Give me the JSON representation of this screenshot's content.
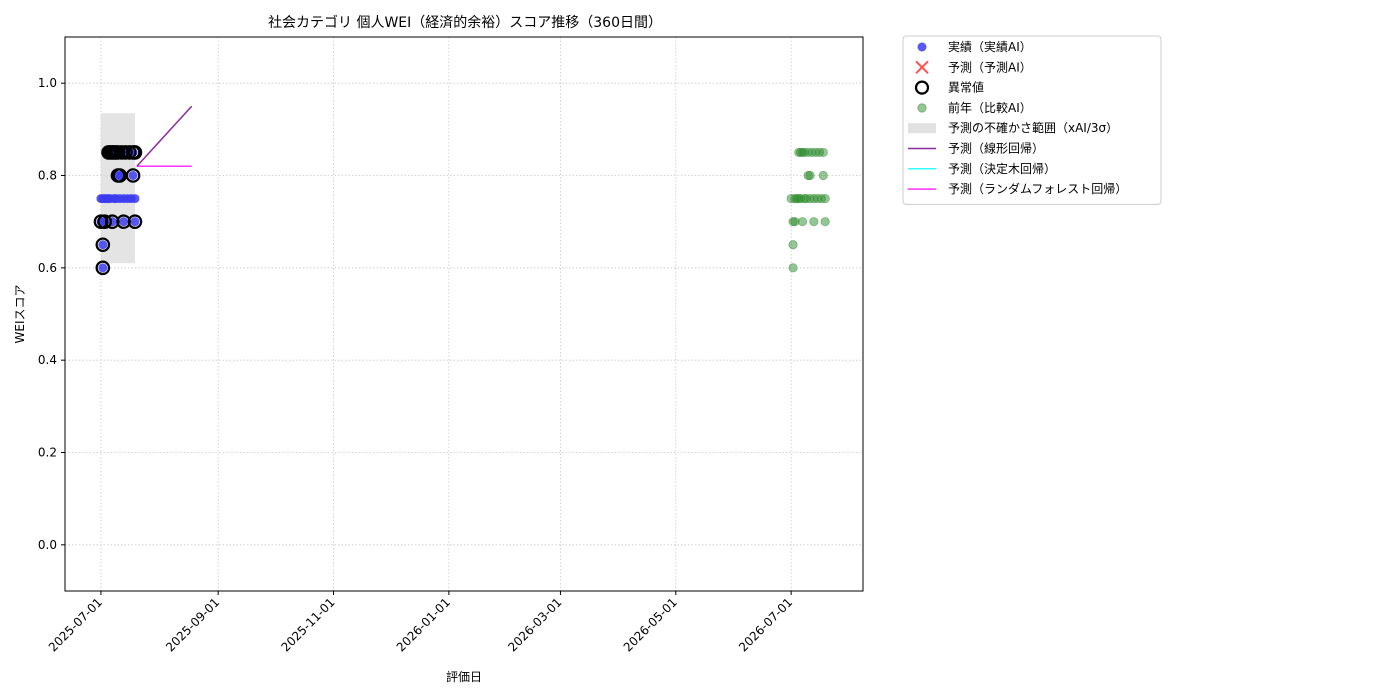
{
  "chart_data": {
    "type": "scatter",
    "title": "社会カテゴリ 個人WEI（経済的余裕）スコア推移（360日間）",
    "xlabel": "評価日",
    "ylabel": "WEIスコア",
    "xlim": [
      "2025-06-12",
      "2026-08-08"
    ],
    "ylim": [
      -0.1,
      1.1
    ],
    "xticks": [
      "2025-07-01",
      "2025-09-01",
      "2025-11-01",
      "2026-01-01",
      "2026-03-01",
      "2026-05-01",
      "2026-07-01"
    ],
    "yticks": [
      0.0,
      0.2,
      0.4,
      0.6,
      0.8,
      1.0
    ],
    "ytick_labels": [
      "0.0",
      "0.2",
      "0.4",
      "0.6",
      "0.8",
      "1.0"
    ],
    "grid": true,
    "legend_position": "outside-upper-right",
    "colors": {
      "actual": "#3b3bf0",
      "forecast": "#ff3333",
      "anomaly": "#000000",
      "previous_year": "#2e8b2e",
      "uncertainty": "#d9d9d9",
      "linear": "#8b2a9e",
      "tree": "#33ffff",
      "forest": "#ff33ff"
    },
    "legend": [
      {
        "key": "actual",
        "label": "実績（実績AI）",
        "marker": "dot"
      },
      {
        "key": "forecast",
        "label": "予測（予測AI）",
        "marker": "x"
      },
      {
        "key": "anomaly",
        "label": "異常値",
        "marker": "ring"
      },
      {
        "key": "previous_year",
        "label": "前年（比較AI）",
        "marker": "dot-faded"
      },
      {
        "key": "uncertainty",
        "label": "予測の不確かさ範囲（xAI/3σ）",
        "marker": "patch"
      },
      {
        "key": "linear",
        "label": "予測（線形回帰）",
        "marker": "line"
      },
      {
        "key": "tree",
        "label": "予測（決定木回帰）",
        "marker": "line"
      },
      {
        "key": "forest",
        "label": "予測（ランダムフォレスト回帰）",
        "marker": "line"
      }
    ],
    "series": [
      {
        "key": "actual",
        "type": "scatter",
        "points": [
          {
            "x": "2025-07-01",
            "y": 0.75
          },
          {
            "x": "2025-07-01",
            "y": 0.7
          },
          {
            "x": "2025-07-02",
            "y": 0.6
          },
          {
            "x": "2025-07-02",
            "y": 0.65
          },
          {
            "x": "2025-07-02",
            "y": 0.75
          },
          {
            "x": "2025-07-03",
            "y": 0.7
          },
          {
            "x": "2025-07-03",
            "y": 0.75
          },
          {
            "x": "2025-07-04",
            "y": 0.75
          },
          {
            "x": "2025-07-05",
            "y": 0.85
          },
          {
            "x": "2025-07-05",
            "y": 0.75
          },
          {
            "x": "2025-07-06",
            "y": 0.85
          },
          {
            "x": "2025-07-06",
            "y": 0.75
          },
          {
            "x": "2025-07-07",
            "y": 0.7
          },
          {
            "x": "2025-07-07",
            "y": 0.85
          },
          {
            "x": "2025-07-08",
            "y": 0.75
          },
          {
            "x": "2025-07-08",
            "y": 0.85
          },
          {
            "x": "2025-07-09",
            "y": 0.75
          },
          {
            "x": "2025-07-10",
            "y": 0.8
          },
          {
            "x": "2025-07-10",
            "y": 0.85
          },
          {
            "x": "2025-07-11",
            "y": 0.75
          },
          {
            "x": "2025-07-11",
            "y": 0.8
          },
          {
            "x": "2025-07-12",
            "y": 0.85
          },
          {
            "x": "2025-07-13",
            "y": 0.7
          },
          {
            "x": "2025-07-13",
            "y": 0.75
          },
          {
            "x": "2025-07-14",
            "y": 0.85
          },
          {
            "x": "2025-07-15",
            "y": 0.75
          },
          {
            "x": "2025-07-16",
            "y": 0.85
          },
          {
            "x": "2025-07-17",
            "y": 0.75
          },
          {
            "x": "2025-07-18",
            "y": 0.8
          },
          {
            "x": "2025-07-18",
            "y": 0.85
          },
          {
            "x": "2025-07-19",
            "y": 0.7
          },
          {
            "x": "2025-07-19",
            "y": 0.75
          }
        ]
      },
      {
        "key": "anomaly",
        "type": "scatter",
        "points": [
          {
            "x": "2025-07-02",
            "y": 0.6
          },
          {
            "x": "2025-07-02",
            "y": 0.65
          },
          {
            "x": "2025-07-01",
            "y": 0.7
          },
          {
            "x": "2025-07-03",
            "y": 0.7
          },
          {
            "x": "2025-07-07",
            "y": 0.7
          },
          {
            "x": "2025-07-13",
            "y": 0.7
          },
          {
            "x": "2025-07-19",
            "y": 0.7
          },
          {
            "x": "2025-07-10",
            "y": 0.8
          },
          {
            "x": "2025-07-11",
            "y": 0.8
          },
          {
            "x": "2025-07-18",
            "y": 0.8
          },
          {
            "x": "2025-07-05",
            "y": 0.85
          },
          {
            "x": "2025-07-06",
            "y": 0.85
          },
          {
            "x": "2025-07-07",
            "y": 0.85
          },
          {
            "x": "2025-07-08",
            "y": 0.85
          },
          {
            "x": "2025-07-09",
            "y": 0.85
          },
          {
            "x": "2025-07-10",
            "y": 0.85
          },
          {
            "x": "2025-07-12",
            "y": 0.85
          },
          {
            "x": "2025-07-14",
            "y": 0.85
          },
          {
            "x": "2025-07-16",
            "y": 0.85
          },
          {
            "x": "2025-07-18",
            "y": 0.85
          },
          {
            "x": "2025-07-19",
            "y": 0.85
          }
        ]
      },
      {
        "key": "previous_year",
        "type": "scatter",
        "points": [
          {
            "x": "2026-07-01",
            "y": 0.75
          },
          {
            "x": "2026-07-02",
            "y": 0.6
          },
          {
            "x": "2026-07-02",
            "y": 0.7
          },
          {
            "x": "2026-07-02",
            "y": 0.65
          },
          {
            "x": "2026-07-03",
            "y": 0.7
          },
          {
            "x": "2026-07-03",
            "y": 0.75
          },
          {
            "x": "2026-07-04",
            "y": 0.75
          },
          {
            "x": "2026-07-05",
            "y": 0.85
          },
          {
            "x": "2026-07-05",
            "y": 0.75
          },
          {
            "x": "2026-07-06",
            "y": 0.85
          },
          {
            "x": "2026-07-06",
            "y": 0.75
          },
          {
            "x": "2026-07-07",
            "y": 0.7
          },
          {
            "x": "2026-07-07",
            "y": 0.85
          },
          {
            "x": "2026-07-08",
            "y": 0.75
          },
          {
            "x": "2026-07-08",
            "y": 0.85
          },
          {
            "x": "2026-07-09",
            "y": 0.75
          },
          {
            "x": "2026-07-10",
            "y": 0.8
          },
          {
            "x": "2026-07-10",
            "y": 0.85
          },
          {
            "x": "2026-07-11",
            "y": 0.75
          },
          {
            "x": "2026-07-11",
            "y": 0.8
          },
          {
            "x": "2026-07-12",
            "y": 0.85
          },
          {
            "x": "2026-07-13",
            "y": 0.7
          },
          {
            "x": "2026-07-13",
            "y": 0.75
          },
          {
            "x": "2026-07-14",
            "y": 0.85
          },
          {
            "x": "2026-07-15",
            "y": 0.75
          },
          {
            "x": "2026-07-16",
            "y": 0.85
          },
          {
            "x": "2026-07-17",
            "y": 0.75
          },
          {
            "x": "2026-07-18",
            "y": 0.8
          },
          {
            "x": "2026-07-18",
            "y": 0.85
          },
          {
            "x": "2026-07-19",
            "y": 0.7
          },
          {
            "x": "2026-07-19",
            "y": 0.75
          }
        ]
      },
      {
        "key": "uncertainty",
        "type": "band",
        "x_start": "2025-07-01",
        "x_end": "2025-07-19",
        "y_low": 0.61,
        "y_high": 0.935
      },
      {
        "key": "linear",
        "type": "line",
        "points": [
          {
            "x": "2025-07-20",
            "y": 0.82
          },
          {
            "x": "2025-08-18",
            "y": 0.95
          }
        ]
      },
      {
        "key": "forest",
        "type": "line",
        "points": [
          {
            "x": "2025-07-20",
            "y": 0.82
          },
          {
            "x": "2025-08-18",
            "y": 0.82
          }
        ]
      }
    ]
  }
}
